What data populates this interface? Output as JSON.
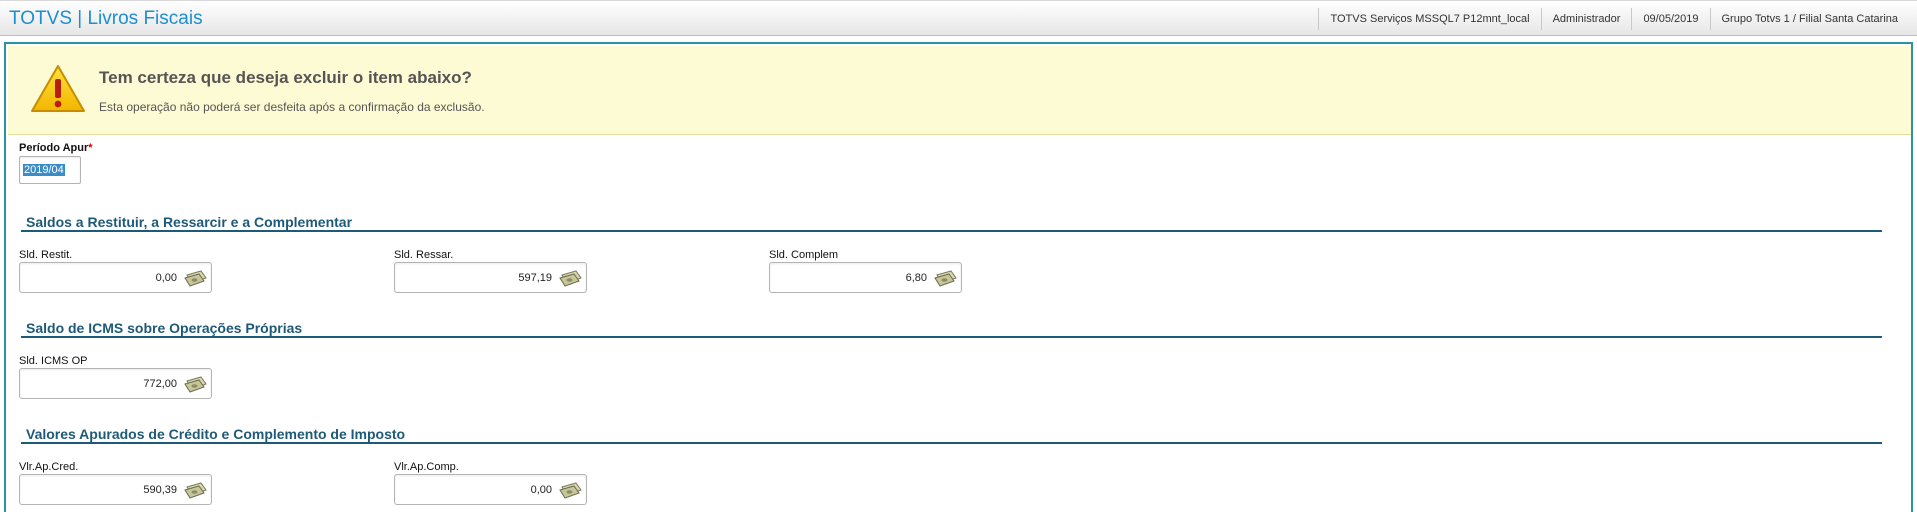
{
  "header": {
    "app_title": "TOTVS | Livros Fiscais",
    "environment": "TOTVS Serviços MSSQL7 P12mnt_local",
    "user": "Administrador",
    "date": "09/05/2019",
    "company": "Grupo Totvs 1 / Filial Santa Catarina"
  },
  "warning": {
    "icon": "warning-icon",
    "title": "Tem certeza que deseja excluir o item abaixo?",
    "message": "Esta operação não poderá ser desfeita após a confirmação da exclusão."
  },
  "period": {
    "label": "Período Apur",
    "required_mark": "*",
    "value": "2019/04"
  },
  "sections": {
    "saldos": {
      "title": "Saldos a Restituir, a Ressarcir e a Complementar",
      "fields": [
        {
          "label": "Sld. Restit.",
          "value": "0,00"
        },
        {
          "label": "Sld. Ressar.",
          "value": "597,19"
        },
        {
          "label": "Sld. Complem",
          "value": "6,80"
        }
      ]
    },
    "icms": {
      "title": "Saldo de ICMS sobre Operações Próprias",
      "fields": [
        {
          "label": "Sld. ICMS OP",
          "value": "772,00"
        }
      ]
    },
    "valores": {
      "title": "Valores Apurados de Crédito e Complemento de Imposto",
      "fields": [
        {
          "label": "Vlr.Ap.Cred.",
          "value": "590,39"
        },
        {
          "label": "Vlr.Ap.Comp.",
          "value": "0,00"
        }
      ]
    }
  },
  "colors": {
    "accent": "#1c8fd1",
    "section_title": "#1e5a78",
    "frame_border": "#2a93a8",
    "warning_bg": "#fdfbd3"
  },
  "icons": {
    "money_button": "money-calculator-icon"
  }
}
